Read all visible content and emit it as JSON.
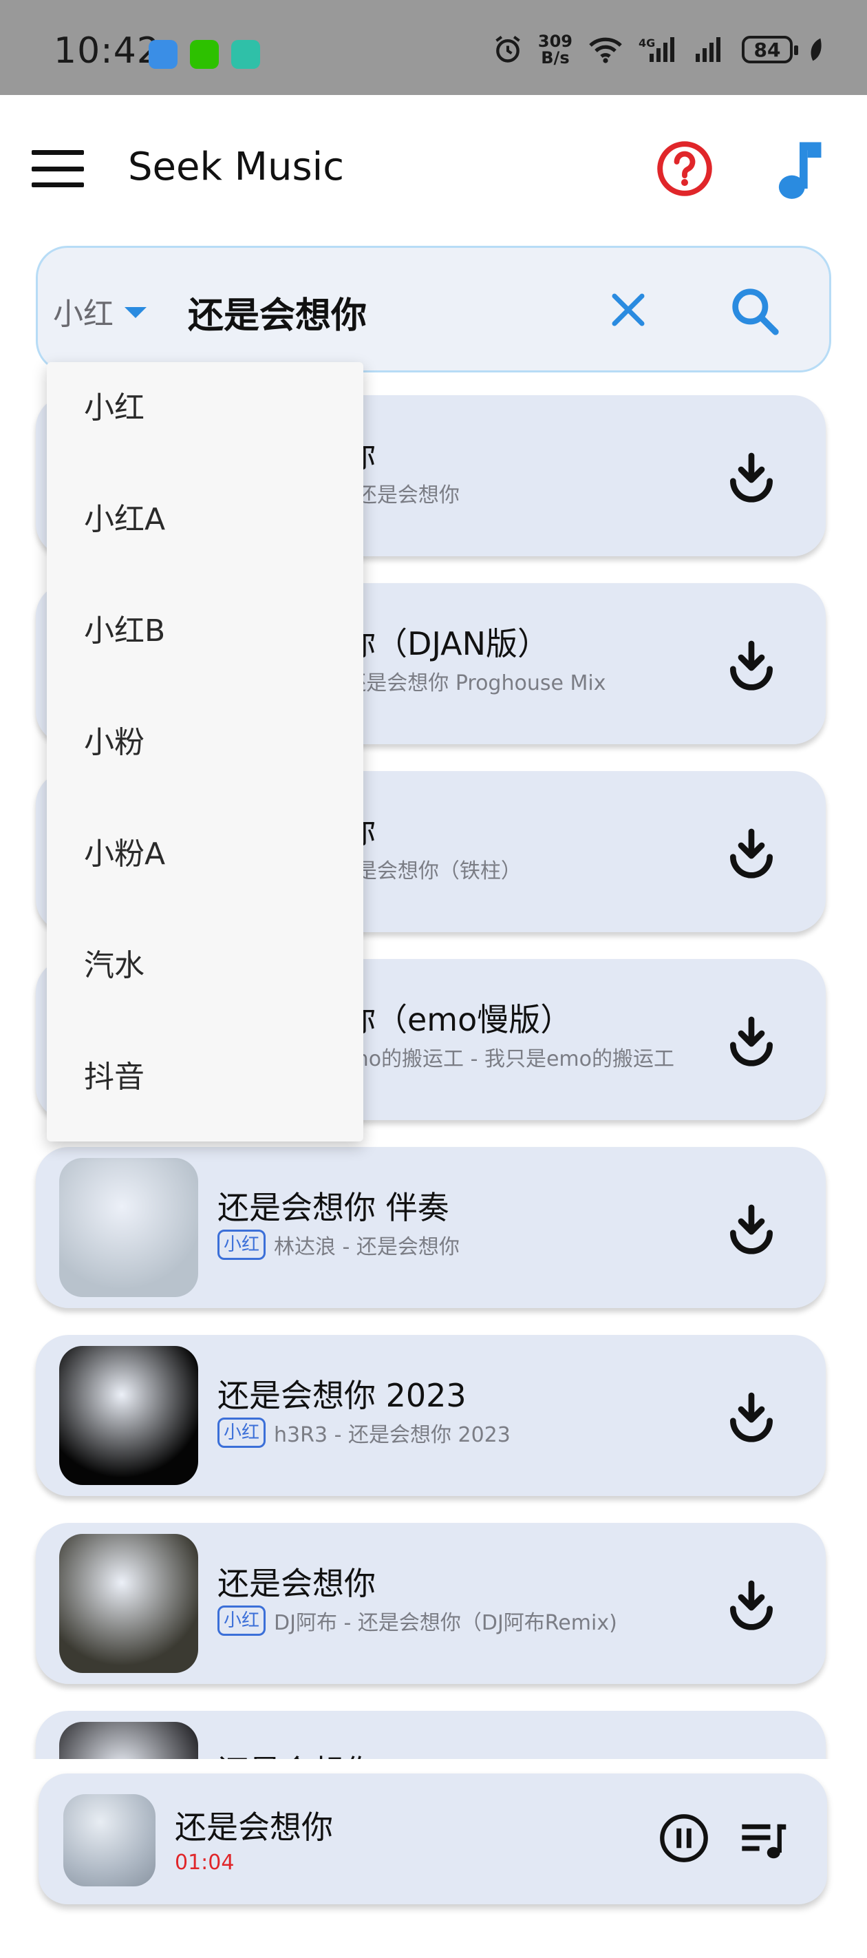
{
  "status_bar": {
    "time": "10:42",
    "network_speed_value": "309",
    "network_speed_unit": "B/s",
    "battery": "84"
  },
  "app_bar": {
    "title": "Seek Music"
  },
  "search": {
    "source": "小红",
    "query": "还是会想你"
  },
  "dropdown": {
    "options": [
      "小红",
      "小红A",
      "小红B",
      "小粉",
      "小粉A",
      "汽水",
      "抖音"
    ]
  },
  "results": [
    {
      "title": "还是会想你",
      "source": "小红",
      "subtitle": "林达浪 - 还是会想你",
      "thumb_color": "#aab6c4"
    },
    {
      "title": "还是会想你（DJAN版）",
      "source": "小红",
      "subtitle": "DJAN - 还是会想你 Proghouse Mix",
      "thumb_color": "#4a5a70"
    },
    {
      "title": "还是会想你",
      "source": "小红",
      "subtitle": "铁柱 - 还是会想你（铁柱）",
      "thumb_color": "#8a8f9a"
    },
    {
      "title": "还是会想你（emo慢版）",
      "source": "小红",
      "subtitle": "我只是emo的搬运工 - 我只是emo的搬运工",
      "thumb_color": "#3a3f4a"
    },
    {
      "title": "还是会想你 伴奏",
      "source": "小红",
      "subtitle": "林达浪 - 还是会想你",
      "thumb_color": "#b8c2cc"
    },
    {
      "title": "还是会想你 2023",
      "source": "小红",
      "subtitle": "h3R3 - 还是会想你 2023",
      "thumb_color": "#050505"
    },
    {
      "title": "还是会想你",
      "source": "小红",
      "subtitle": "DJ阿布 - 还是会想你（DJ阿布Remix)",
      "thumb_color": "#3b3a32"
    },
    {
      "title": "还是会想你",
      "source": "小红",
      "subtitle": "",
      "thumb_color": "#2a2a2e"
    }
  ],
  "player": {
    "title": "还是会想你",
    "time": "01:04"
  },
  "colors": {
    "accent_blue": "#2a8be0",
    "help_red": "#e0262a",
    "card_bg": "#e2e8f4"
  }
}
